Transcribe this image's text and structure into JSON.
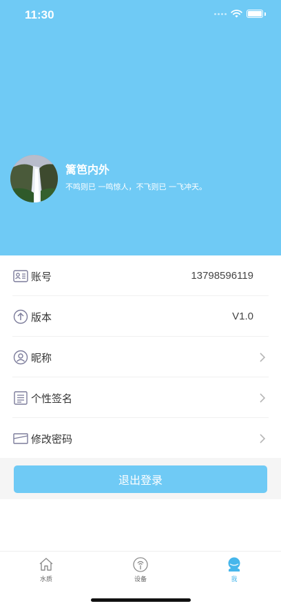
{
  "status_bar": {
    "time": "11:30"
  },
  "profile": {
    "name": "篱笆内外",
    "bio": "不鸣则已 一鸣惊人，不飞则已 一飞冲天。"
  },
  "settings": {
    "rows": [
      {
        "label": "账号",
        "value": "13798596119",
        "icon": "id-card-icon"
      },
      {
        "label": "版本",
        "value": "V1.0",
        "icon": "arrow-up-circle-icon"
      },
      {
        "label": "昵称",
        "icon": "user-circle-icon"
      },
      {
        "label": "个性签名",
        "icon": "document-icon"
      },
      {
        "label": "修改密码",
        "icon": "envelope-icon"
      }
    ]
  },
  "logout": {
    "label": "退出登录"
  },
  "tabbar": {
    "items": [
      {
        "label": "水质",
        "icon": "house-icon"
      },
      {
        "label": "设备",
        "icon": "device-icon"
      },
      {
        "label": "我",
        "icon": "profile-icon"
      }
    ]
  },
  "colors": {
    "accent": "#6FCAF5",
    "active_tab": "#46B6EB"
  }
}
